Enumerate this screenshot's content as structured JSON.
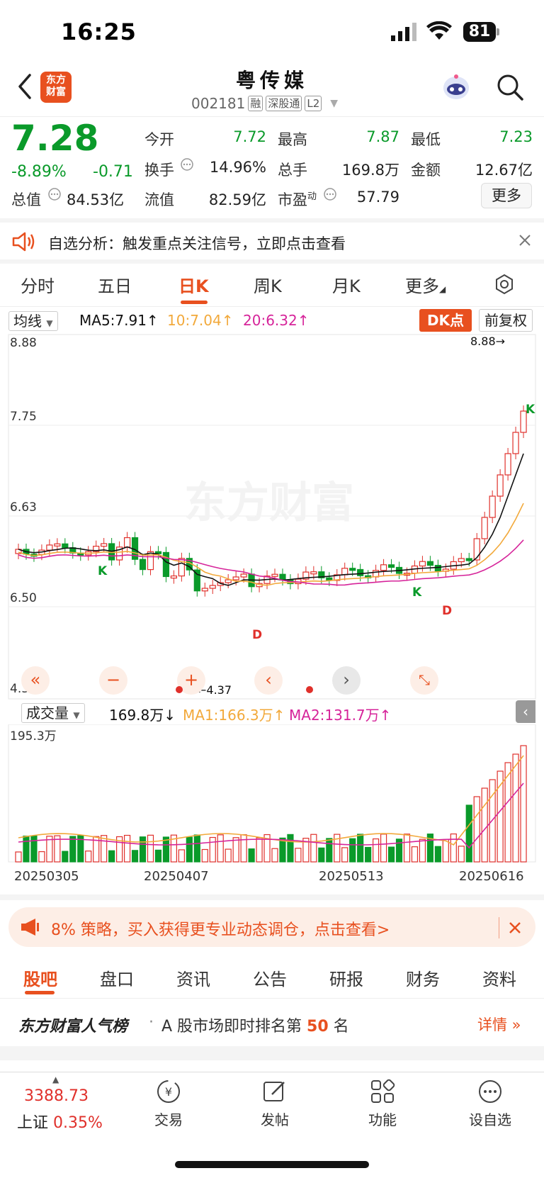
{
  "status": {
    "time": "16:25",
    "battery": "81"
  },
  "header": {
    "title": "粤传媒",
    "code": "002181",
    "tags": [
      "融",
      "深股通",
      "L2"
    ],
    "logo_text": "东方财富"
  },
  "quote": {
    "price": "7.28",
    "change_pct": "-8.89%",
    "change": "-0.71",
    "total_value_label": "总值",
    "total_value": "84.53亿",
    "fields": [
      {
        "label": "今开",
        "value": "7.72",
        "color": "green"
      },
      {
        "label": "最高",
        "value": "7.87",
        "color": "green"
      },
      {
        "label": "最低",
        "value": "7.23",
        "color": "green"
      },
      {
        "label": "换手",
        "value": "14.96%",
        "color": "dark"
      },
      {
        "label": "总手",
        "value": "169.8万",
        "color": "dark"
      },
      {
        "label": "金额",
        "value": "12.67亿",
        "color": "dark"
      },
      {
        "label": "流值",
        "value": "82.59亿",
        "color": "dark"
      },
      {
        "label": "市盈",
        "sup": "动",
        "value": "57.79",
        "color": "dark"
      }
    ],
    "more_label": "更多"
  },
  "notice": {
    "text": "自选分析：触发重点关注信号，立即点击查看"
  },
  "ktabs": [
    "分时",
    "五日",
    "日K",
    "周K",
    "月K",
    "更多"
  ],
  "ktab_active": 2,
  "kline": {
    "ma_select": "均线",
    "ma5": "MA5:7.91↑",
    "ma10": "10:7.04↑",
    "ma20": "20:6.32↑",
    "dk_label": "DK点",
    "fq_label": "前复权",
    "y_labels": [
      "8.88",
      "7.75",
      "6.63",
      "6.50",
      "4.37"
    ],
    "max_marker": "8.88→",
    "min_marker": "←4.37",
    "watermark": "东方财富",
    "k_marks": [
      "K",
      "K",
      "K"
    ],
    "d_marks": [
      "D",
      "D"
    ]
  },
  "volume": {
    "select": "成交量",
    "current": "169.8万↓",
    "ma1": "MA1:166.3万↑",
    "ma2": "MA2:131.7万↑",
    "max_label": "195.3万",
    "dates": [
      "20250305",
      "20250407",
      "20250513",
      "20250616"
    ]
  },
  "promo": {
    "text": "8% 策略，买入获得更专业动态调仓，点击查看>"
  },
  "btabs": [
    "股吧",
    "盘口",
    "资讯",
    "公告",
    "研报",
    "财务",
    "资料"
  ],
  "btab_active": 0,
  "rank": {
    "title": "东方财富人气榜",
    "text": "A 股市场即时排名第",
    "rank": "50",
    "suffix": "名",
    "detail": "详情"
  },
  "footer": {
    "index_value": "3388.73",
    "index_name": "上证",
    "index_change": "0.35%",
    "items": [
      "交易",
      "发帖",
      "功能",
      "设自选"
    ]
  },
  "colors": {
    "accent": "#e8501f",
    "up": "#e0302b",
    "down": "#0a9a2a",
    "ma10": "#f2a93b",
    "ma20": "#d6249a"
  }
}
